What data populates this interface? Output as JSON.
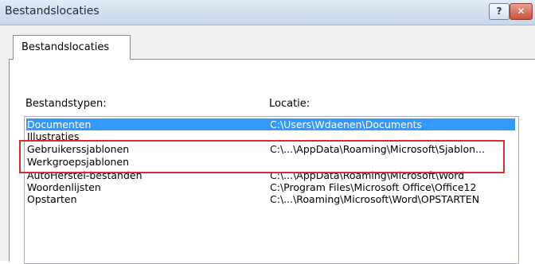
{
  "window": {
    "title": "Bestandslocaties",
    "help_label": "?",
    "close_label": "✕"
  },
  "tabs": [
    {
      "label": "Bestandslocaties",
      "active": true
    }
  ],
  "list": {
    "column_type": "Bestandstypen:",
    "column_location": "Locatie:",
    "rows": [
      {
        "type": "Documenten",
        "location": "C:\\Users\\Wdaenen\\Documents",
        "selected": true
      },
      {
        "type": "Illustraties",
        "location": ""
      },
      {
        "type": "Gebruikerssjablonen",
        "location": "C:\\...\\AppData\\Roaming\\Microsoft\\Sjablon...",
        "highlighted": true
      },
      {
        "type": "Werkgroepsjablonen",
        "location": "",
        "highlighted": true
      },
      {
        "type": "AutoHerstel-bestanden",
        "location": "C:\\...\\AppData\\Roaming\\Microsoft\\Word"
      },
      {
        "type": "Woordenlijsten",
        "location": "C:\\Program Files\\Microsoft Office\\Office12"
      },
      {
        "type": "Opstarten",
        "location": "C:\\...\\Roaming\\Microsoft\\Word\\OPSTARTEN"
      }
    ]
  },
  "colors": {
    "selection": "#3399ff",
    "highlight_border": "#e0282e"
  }
}
